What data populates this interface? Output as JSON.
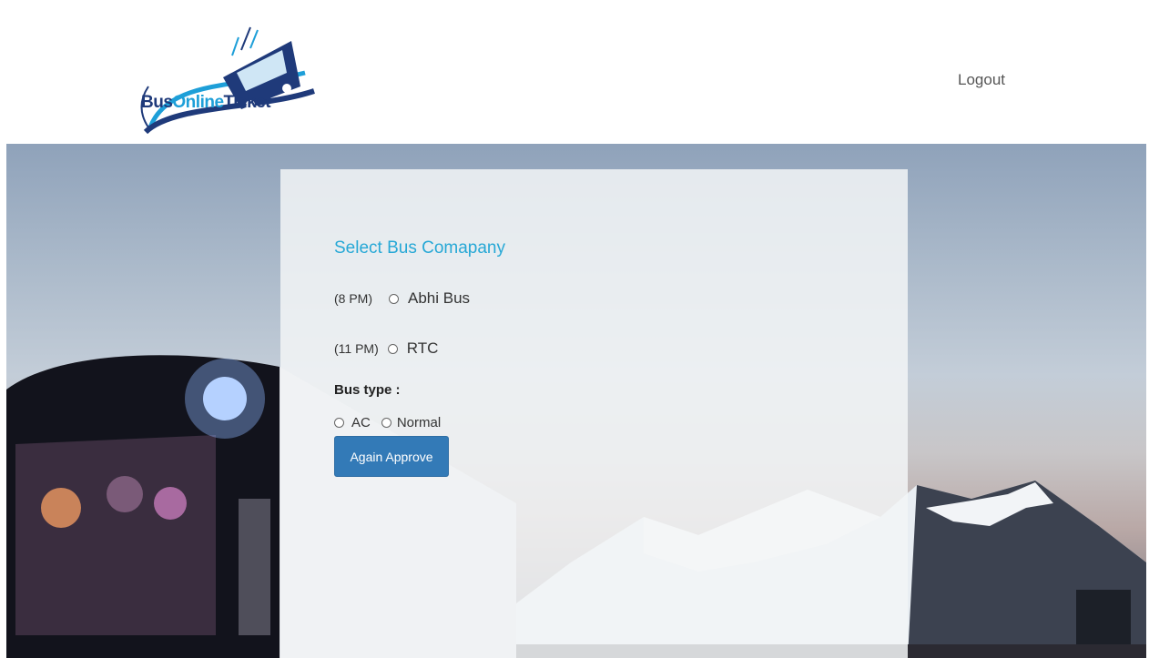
{
  "header": {
    "logo": {
      "part1": "Bus",
      "part2": "Online",
      "part3": "Ticket"
    },
    "logout_label": "Logout"
  },
  "form": {
    "title": "Select Bus Comapany",
    "companies": [
      {
        "time": "(8 PM)",
        "name": "Abhi Bus",
        "selected": false
      },
      {
        "time": "(11 PM)",
        "name": "RTC",
        "selected": false
      }
    ],
    "bus_type_label": "Bus type :",
    "bus_types": [
      {
        "label": "AC",
        "selected": false
      },
      {
        "label": "Normal",
        "selected": false
      }
    ],
    "submit_label": "Again Approve"
  },
  "colors": {
    "title": "#27a8d6",
    "button": "#337ab7",
    "logo_dark": "#1f3a7a",
    "logo_light": "#1e9fd8"
  },
  "icons": [
    "bus-logo-icon"
  ]
}
